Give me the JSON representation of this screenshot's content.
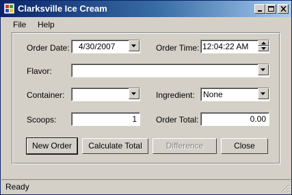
{
  "window": {
    "title": "Clarksville Ice Cream",
    "controls": {
      "minimize": "minimize-icon",
      "maximize": "maximize-icon",
      "close": "close-icon"
    }
  },
  "menu": [
    {
      "label": "File"
    },
    {
      "label": "Help"
    }
  ],
  "form": {
    "order_date": {
      "label": "Order Date:",
      "value": "4/30/2007"
    },
    "order_time": {
      "label": "Order Time:",
      "value": "12:04:22 AM"
    },
    "flavor": {
      "label": "Flavor:",
      "value": ""
    },
    "container": {
      "label": "Container:",
      "value": ""
    },
    "ingredient": {
      "label": "Ingredient:",
      "value": "None"
    },
    "scoops": {
      "label": "Scoops:",
      "value": "1"
    },
    "order_total": {
      "label": "Order Total:",
      "value": "0.00"
    }
  },
  "buttons": {
    "new_order": "New Order",
    "calculate_total": "Calculate Total",
    "difference": "Difference",
    "close": "Close"
  },
  "status": {
    "text": "Ready"
  },
  "colors": {
    "title_start": "#0a246a",
    "title_end": "#a6caf0",
    "face": "#d4d0c8",
    "disabled_text": "#808080"
  }
}
